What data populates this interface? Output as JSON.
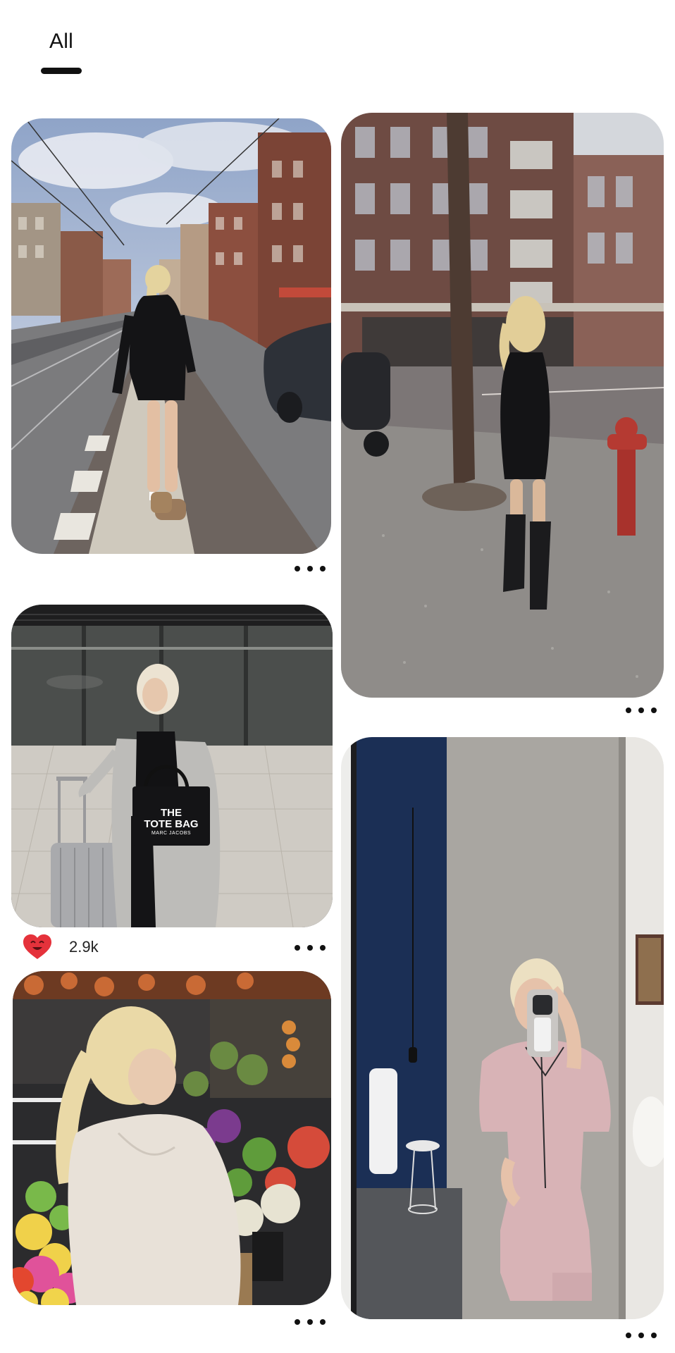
{
  "tabs": [
    {
      "label": "All",
      "active": true
    }
  ],
  "pins": [
    {
      "id": "street-tram",
      "scene": "street-tram",
      "more_icon": "more-dots-icon"
    },
    {
      "id": "corner-street",
      "scene": "corner-street",
      "more_icon": "more-dots-icon"
    },
    {
      "id": "station-tote",
      "scene": "station-tote",
      "bag_text": [
        "THE",
        "TOTE BAG",
        "MARC JACOBS"
      ],
      "reaction_icon": "heart-face-icon",
      "reaction_count": "2.9k",
      "more_icon": "more-dots-icon"
    },
    {
      "id": "mirror-selfie",
      "scene": "mirror-selfie",
      "more_icon": "more-dots-icon"
    },
    {
      "id": "flower-market",
      "scene": "flower-market",
      "more_icon": "more-dots-icon"
    }
  ],
  "colors": {
    "text": "#111111",
    "background": "#ffffff",
    "heart": "#e5323b"
  }
}
